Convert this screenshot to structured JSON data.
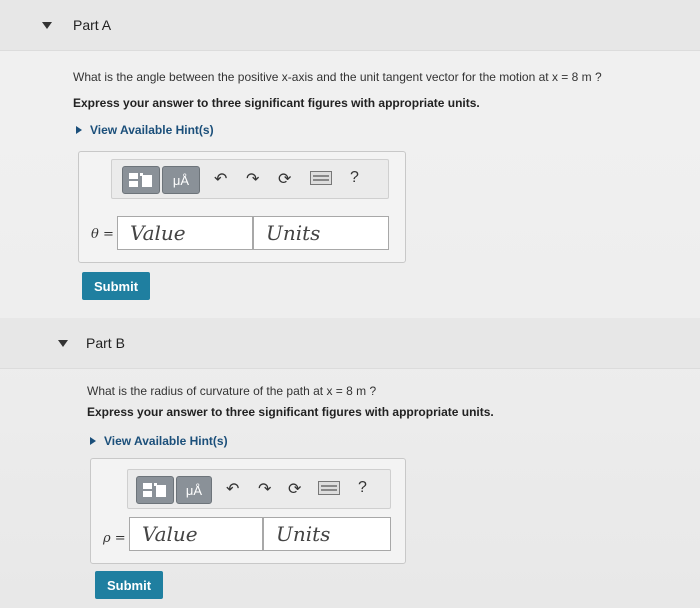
{
  "partA": {
    "title": "Part A",
    "question": "What is the angle between the positive x-axis and the unit tangent vector for the motion at x = 8 m ?",
    "instruction": "Express your answer to three significant figures with appropriate units.",
    "hint_label": "View Available Hint(s)",
    "var_label": "θ =",
    "value_placeholder": "Value",
    "units_placeholder": "Units",
    "submit_label": "Submit"
  },
  "partB": {
    "title": "Part B",
    "question": "What is the radius of curvature of the path at x = 8 m ?",
    "instruction": "Express your answer to three significant figures with appropriate units.",
    "hint_label": "View Available Hint(s)",
    "var_label": "ρ =",
    "value_placeholder": "Value",
    "units_placeholder": "Units",
    "submit_label": "Submit"
  },
  "toolbar": {
    "mu_label": "μÅ",
    "help_label": "?",
    "icons": [
      "templates-icon",
      "units-icon",
      "undo-icon",
      "redo-icon",
      "reset-icon",
      "keyboard-icon",
      "help-icon"
    ]
  },
  "colors": {
    "submit_bg": "#1f7fa0",
    "hint_text": "#1b4f7a"
  }
}
